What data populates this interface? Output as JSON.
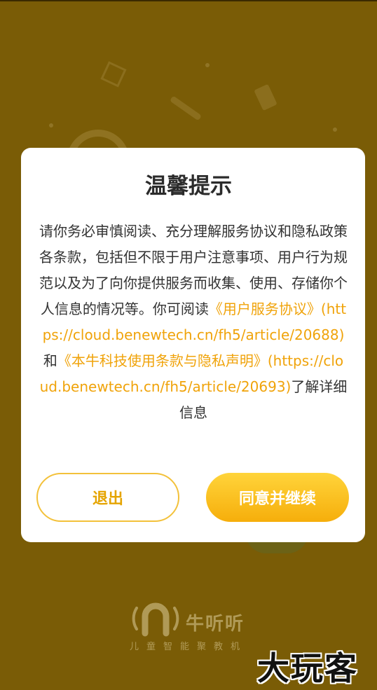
{
  "dialog": {
    "title": "温馨提示",
    "message_intro": "请你务必审慎阅读、充分理解服务协议和隐私政策各条款，包括但不限于用户注意事项、用户行为规范以及为了向你提供服务而收集、使用、存储你个人信息的情况等。你可阅读",
    "link_service": "《用户服务协议》(https://cloud.benewtech.cn/fh5/article/20688)",
    "connector": "和",
    "link_privacy": "《本牛科技使用条款与隐私声明》(https://cloud.benewtech.cn/fh5/article/20693)",
    "message_outro": "了解详细信息",
    "exit_label": "退出",
    "agree_label": "同意并继续",
    "link_color": "#f0a30a",
    "accent_color": "#f6ae0b"
  },
  "brand": {
    "name": "牛听听",
    "tagline": "儿童智能聚教机"
  },
  "watermark": "大玩客",
  "background_color": "#7a5c06"
}
